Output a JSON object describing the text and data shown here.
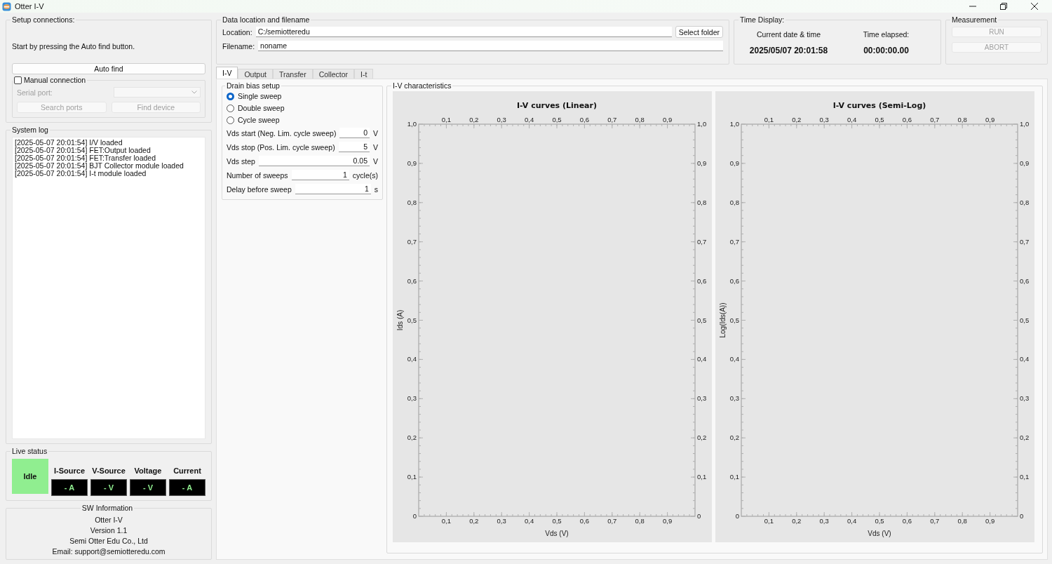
{
  "window": {
    "title": "Otter I-V"
  },
  "setup_connections": {
    "title": "Setup connections:",
    "instruction": "Start by pressing the Auto find button.",
    "auto_find_button": "Auto find",
    "manual_connection": {
      "label": "Manual connection",
      "checked": false
    },
    "serial_port_label": "Serial port:",
    "search_ports_button": "Search ports",
    "find_device_button": "Find device"
  },
  "system_log": {
    "title": "System log",
    "lines": [
      "[2025-05-07 20:01:54] I/V loaded",
      "[2025-05-07 20:01:54] FET:Output loaded",
      "[2025-05-07 20:01:54] FET:Transfer loaded",
      "[2025-05-07 20:01:54] BJT Collector module loaded",
      "[2025-05-07 20:01:54] I-t module loaded"
    ]
  },
  "live_status": {
    "title": "Live status",
    "state": "Idle",
    "readouts": [
      {
        "label": "I-Source",
        "value": "- A"
      },
      {
        "label": "V-Source",
        "value": "- V"
      },
      {
        "label": "Voltage",
        "value": "- V"
      },
      {
        "label": "Current",
        "value": "- A"
      }
    ]
  },
  "sw_information": {
    "title": "SW Information",
    "lines": [
      "Otter I-V",
      "Version 1.1",
      "Semi Otter Edu Co., Ltd",
      "Email: support@semiotteredu.com"
    ]
  },
  "data_location": {
    "title": "Data location and filename",
    "location_label": "Location:",
    "location_value": "C:/semiotteredu",
    "select_folder_button": "Select folder",
    "filename_label": "Filename:",
    "filename_value": "noname"
  },
  "time_display": {
    "title": "Time Display:",
    "current_label": "Current date & time",
    "current_value": "2025/05/07 20:01:58",
    "elapsed_label": "Time elapsed:",
    "elapsed_value": "00:00:00.00"
  },
  "measurement": {
    "title": "Measurement",
    "buttons": [
      {
        "label": "RUN",
        "disabled": true
      },
      {
        "label": "ABORT",
        "disabled": true
      }
    ]
  },
  "tabs": [
    {
      "label": "I-V",
      "selected": true
    },
    {
      "label": "Output",
      "selected": false
    },
    {
      "label": "Transfer",
      "selected": false
    },
    {
      "label": "Collector",
      "selected": false
    },
    {
      "label": "I-t",
      "selected": false
    }
  ],
  "drain_bias_setup": {
    "title": "Drain bias setup",
    "sweep_modes": [
      {
        "label": "Single sweep",
        "selected": true
      },
      {
        "label": "Double sweep",
        "selected": false
      },
      {
        "label": "Cycle sweep",
        "selected": false
      }
    ],
    "parameters": [
      {
        "label": "Vds start (Neg. Lim. cycle sweep)",
        "value": "0",
        "unit": "V"
      },
      {
        "label": "Vds stop (Pos. Lim. cycle sweep)",
        "value": "5",
        "unit": "V"
      },
      {
        "label": "Vds step",
        "value": "0.05",
        "unit": "V"
      },
      {
        "label": "Number of sweeps",
        "value": "1",
        "unit": "cycle(s)"
      },
      {
        "label": "Delay before sweep",
        "value": "1",
        "unit": "s"
      }
    ]
  },
  "iv_characteristics": {
    "title": "I-V characteristics",
    "charts": [
      {
        "chart_data": {
          "type": "line",
          "title": "I-V curves (Linear)",
          "xlabel": "Vds (V)",
          "ylabel": "Ids (A)",
          "xlim": [
            0,
            1
          ],
          "ylim": [
            0,
            1
          ],
          "xticks": [
            {
              "value": 0.1,
              "label": "0,1"
            },
            {
              "value": 0.2,
              "label": "0,2"
            },
            {
              "value": 0.3,
              "label": "0,3"
            },
            {
              "value": 0.4,
              "label": "0,4"
            },
            {
              "value": 0.5,
              "label": "0,5"
            },
            {
              "value": 0.6,
              "label": "0,6"
            },
            {
              "value": 0.7,
              "label": "0,7"
            },
            {
              "value": 0.8,
              "label": "0,8"
            },
            {
              "value": 0.9,
              "label": "0,9"
            }
          ],
          "yticks": [
            {
              "value": 0,
              "label": "0"
            },
            {
              "value": 0.1,
              "label": "0,1"
            },
            {
              "value": 0.2,
              "label": "0,2"
            },
            {
              "value": 0.3,
              "label": "0,3"
            },
            {
              "value": 0.4,
              "label": "0,4"
            },
            {
              "value": 0.5,
              "label": "0,5"
            },
            {
              "value": 0.6,
              "label": "0,6"
            },
            {
              "value": 0.7,
              "label": "0,7"
            },
            {
              "value": 0.8,
              "label": "0,8"
            },
            {
              "value": 0.9,
              "label": "0,9"
            },
            {
              "value": 1,
              "label": "1,0"
            }
          ]
        }
      },
      {
        "chart_data": {
          "type": "line",
          "title": "I-V curves (Semi-Log)",
          "xlabel": "Vds (V)",
          "ylabel": "Log(Ids(A))",
          "xlim": [
            0,
            1
          ],
          "ylim": [
            0,
            1
          ],
          "xticks": [
            {
              "value": 0.1,
              "label": "0,1"
            },
            {
              "value": 0.2,
              "label": "0,2"
            },
            {
              "value": 0.3,
              "label": "0,3"
            },
            {
              "value": 0.4,
              "label": "0,4"
            },
            {
              "value": 0.5,
              "label": "0,5"
            },
            {
              "value": 0.6,
              "label": "0,6"
            },
            {
              "value": 0.7,
              "label": "0,7"
            },
            {
              "value": 0.8,
              "label": "0,8"
            },
            {
              "value": 0.9,
              "label": "0,9"
            }
          ],
          "yticks": [
            {
              "value": 0,
              "label": "0"
            },
            {
              "value": 0.1,
              "label": "0,1"
            },
            {
              "value": 0.2,
              "label": "0,2"
            },
            {
              "value": 0.3,
              "label": "0,3"
            },
            {
              "value": 0.4,
              "label": "0,4"
            },
            {
              "value": 0.5,
              "label": "0,5"
            },
            {
              "value": 0.6,
              "label": "0,6"
            },
            {
              "value": 0.7,
              "label": "0,7"
            },
            {
              "value": 0.8,
              "label": "0,8"
            },
            {
              "value": 0.9,
              "label": "0,9"
            },
            {
              "value": 1,
              "label": "1,0"
            }
          ]
        }
      }
    ]
  }
}
